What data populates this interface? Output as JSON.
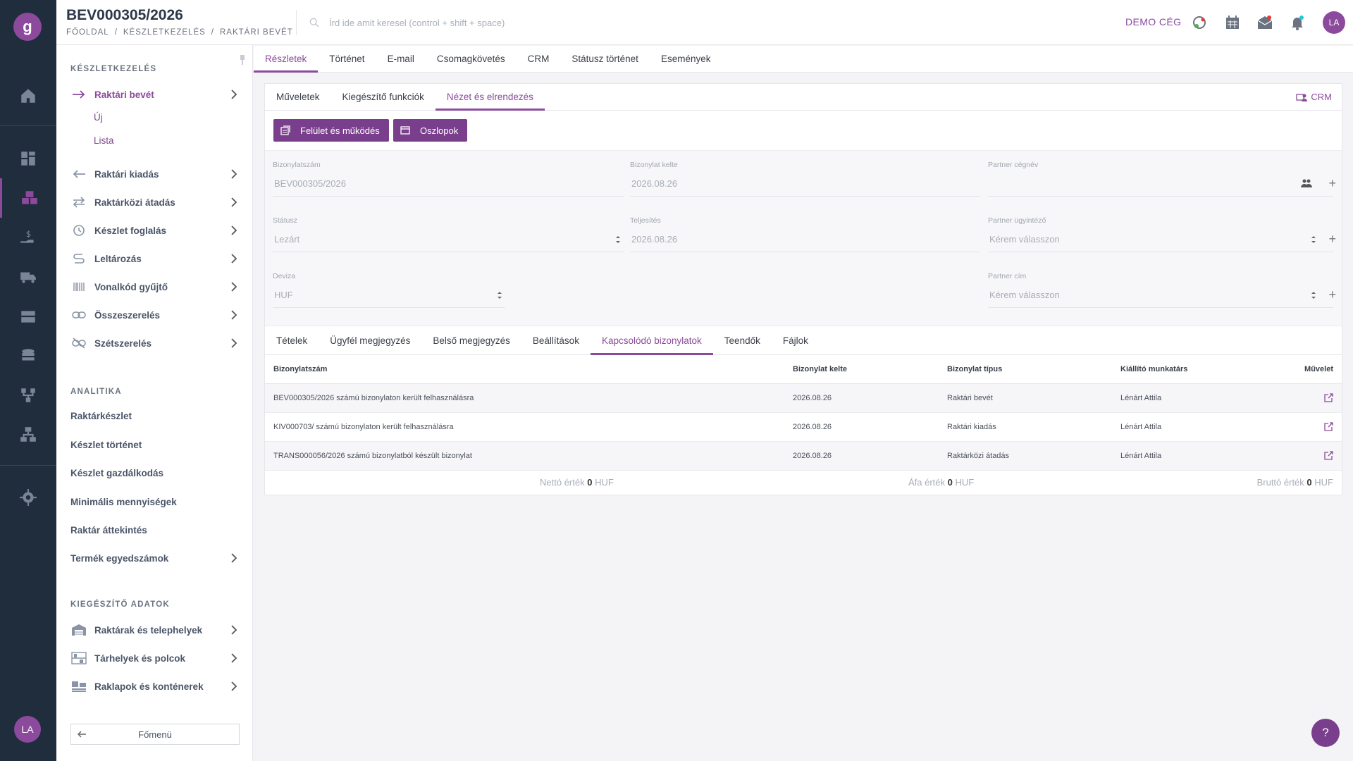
{
  "header": {
    "doc_title": "BEV000305/2026",
    "breadcrumb": [
      "FŐOLDAL",
      "/",
      "KÉSZLETKEZELÉS",
      "/",
      "RAKTÁRI BEVÉT"
    ],
    "search_placeholder": "Írd ide amit keresel (control + shift + space)",
    "company": "DEMO CÉG",
    "avatar": "LA"
  },
  "rail": {
    "logo": "g",
    "avatar": "LA"
  },
  "sidebar": {
    "section1": "KÉSZLETKEZELÉS",
    "active_item": "Raktári bevét",
    "sub_items": [
      "Új",
      "Lista"
    ],
    "items": [
      {
        "label": "Raktári kiadás",
        "icon": "arrow-left-icon"
      },
      {
        "label": "Raktárközi átadás",
        "icon": "transfer-icon"
      },
      {
        "label": "Készlet foglalás",
        "icon": "reserve-icon"
      },
      {
        "label": "Leltározás",
        "icon": "inventory-icon"
      },
      {
        "label": "Vonalkód gyűjtő",
        "icon": "barcode-icon"
      },
      {
        "label": "Összeszerelés",
        "icon": "link-icon"
      },
      {
        "label": "Szétszerelés",
        "icon": "unlink-icon"
      }
    ],
    "section2": "ANALITIKA",
    "analytics": [
      "Raktárkészlet",
      "Készlet történet",
      "Készlet gazdálkodás",
      "Minimális mennyiségek",
      "Raktár áttekintés",
      "Termék egyedszámok"
    ],
    "section3": "KIEGÉSZÍTŐ ADATOK",
    "extra": [
      {
        "label": "Raktárak és telephelyek",
        "icon": "warehouse-icon"
      },
      {
        "label": "Tárhelyek és polcok",
        "icon": "shelf-icon"
      },
      {
        "label": "Raklapok és konténerek",
        "icon": "pallet-icon"
      }
    ],
    "main_menu": "Főmenü"
  },
  "main_tabs": [
    "Részletek",
    "Történet",
    "E-mail",
    "Csomagkövetés",
    "CRM",
    "Státusz történet",
    "Események"
  ],
  "sub_tabs": [
    "Műveletek",
    "Kiegészítő funkciók",
    "Nézet és elrendezés"
  ],
  "crm_link": "CRM",
  "buttons": {
    "ui": "Felület és működés",
    "columns": "Oszlopok"
  },
  "form": {
    "doc_no_label": "Bizonylatszám",
    "doc_no": "BEV000305/2026",
    "date_label": "Bizonylat kelte",
    "date": "2026.08.26",
    "partner_label": "Partner cégnév",
    "partner": "",
    "status_label": "Státusz",
    "status": "Lezárt",
    "fulfil_label": "Teljesítés",
    "fulfil": "2026.08.26",
    "agent_label": "Partner ügyintéző",
    "agent": "Kérem válasszon",
    "currency_label": "Deviza",
    "currency": "HUF",
    "address_label": "Partner cím",
    "address": "Kérem válasszon"
  },
  "rel_tabs": [
    "Tételek",
    "Ügyfél megjegyzés",
    "Belső megjegyzés",
    "Beállítások",
    "Kapcsolódó bizonylatok",
    "Teendők",
    "Fájlok"
  ],
  "table": {
    "headers": [
      "Bizonylatszám",
      "Bizonylat kelte",
      "Bizonylat típus",
      "Kiállító munkatárs",
      "Művelet"
    ],
    "rows": [
      [
        "BEV000305/2026 számú bizonylaton került felhasználásra",
        "2026.08.26",
        "Raktári bevét",
        "Lénárt Attila"
      ],
      [
        "KIV000703/ számú bizonylaton került felhasználásra",
        "2026.08.26",
        "Raktári kiadás",
        "Lénárt Attila"
      ],
      [
        "TRANS000056/2026 számú bizonylatból készült bizonylat",
        "2026.08.26",
        "Raktárközi átadás",
        "Lénárt Attila"
      ]
    ]
  },
  "totals": {
    "net_label": "Nettó érték",
    "net": "0",
    "net_cur": "HUF",
    "vat_label": "Áfa érték",
    "vat": "0",
    "vat_cur": "HUF",
    "gross_label": "Bruttó érték",
    "gross": "0",
    "gross_cur": "HUF"
  },
  "help": "?",
  "colors": {
    "accent": "#8b4a9c",
    "rail": "#1f2d3d"
  }
}
